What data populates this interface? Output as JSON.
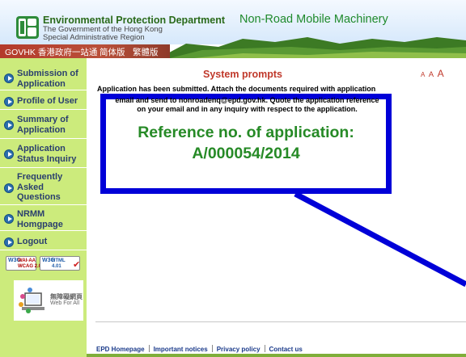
{
  "header": {
    "department_name": "Environmental Protection Department",
    "department_sub_1": "The Government of the Hong Kong",
    "department_sub_2": "Special Administrative Region",
    "site_title": "Non-Road Mobile Machinery",
    "govhk_link": "GOVHK 香港政府一站通",
    "simplified_link": "简体版",
    "traditional_link": "繁體版"
  },
  "sidebar": {
    "items": [
      {
        "label": "Submission of Application"
      },
      {
        "label": "Profile of User"
      },
      {
        "label": "Summary of Application"
      },
      {
        "label": "Application Status Inquiry"
      },
      {
        "label": "Frequently Asked Questions"
      },
      {
        "label": "NRMM Homgpage"
      },
      {
        "label": "Logout"
      }
    ],
    "badges": {
      "w3c": "W3C",
      "wai_text_1": "WAI-AA",
      "wai_text_2": "WCAG 2.0",
      "html_text_1": "HTML",
      "html_text_2": "4.01",
      "web_for_all_zh": "無障礙網頁",
      "web_for_all_en": "Web For All"
    }
  },
  "main": {
    "font_size_small": "A",
    "font_size_medium": "A",
    "font_size_large": "A",
    "system_title": "System prompts",
    "message_line_1": "Application has been submitted. Attach the documents required with application",
    "message_line_2": "email and send to nonroadenq@epd.gov.hk. Quote the application reference",
    "message_line_3": "on your email and in any inquiry with respect to the application.",
    "reference_label": "Reference no. of application:",
    "reference_number": "A/000054/2014"
  },
  "footer": {
    "links": [
      "EPD Homepage",
      "Important notices",
      "Privacy policy",
      "Contact us"
    ]
  },
  "colors": {
    "sidebar_bg": "#cceb7c",
    "highlight_border": "#0000d8",
    "reference_green": "#268a26",
    "prompt_red": "#c0392b"
  }
}
